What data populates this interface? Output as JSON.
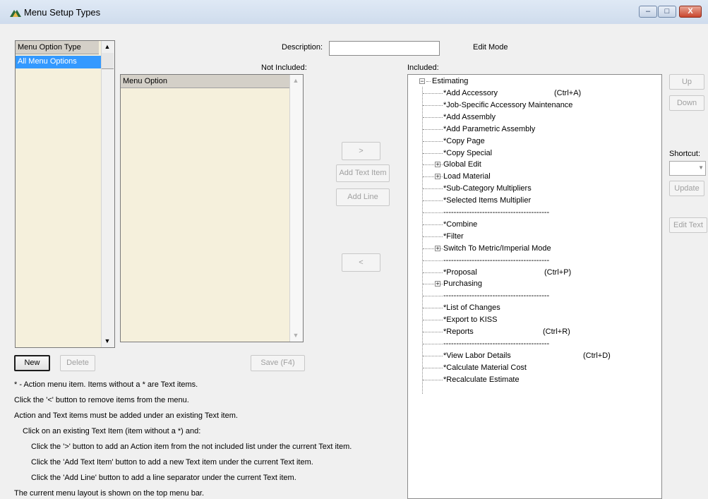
{
  "window": {
    "title": "Menu Setup Types",
    "minimize": "–",
    "maximize": "□",
    "close": "X"
  },
  "menu_type_list": {
    "header": "Menu Option Type",
    "items": [
      "All Menu Options"
    ]
  },
  "description": {
    "label": "Description:",
    "value": ""
  },
  "edit_mode_label": "Edit Mode",
  "not_included": {
    "label": "Not Included:",
    "header": "Menu Option"
  },
  "included": {
    "label": "Included:",
    "root": "Estimating",
    "items": [
      {
        "text": "*Add Accessory",
        "shortcut": "(Ctrl+A)",
        "expander": false
      },
      {
        "text": "*Job-Specific Accessory Maintenance",
        "shortcut": "",
        "expander": false
      },
      {
        "text": "*Add Assembly",
        "shortcut": "",
        "expander": false
      },
      {
        "text": "*Add Parametric Assembly",
        "shortcut": "",
        "expander": false
      },
      {
        "text": "*Copy Page",
        "shortcut": "",
        "expander": false
      },
      {
        "text": "*Copy Special",
        "shortcut": "",
        "expander": false
      },
      {
        "text": "Global Edit",
        "shortcut": "",
        "expander": true
      },
      {
        "text": "Load Material",
        "shortcut": "",
        "expander": true
      },
      {
        "text": "*Sub-Category Multipliers",
        "shortcut": "",
        "expander": false
      },
      {
        "text": "*Selected Items Multiplier",
        "shortcut": "",
        "expander": false
      },
      {
        "text": "-----------------------------------------",
        "shortcut": "",
        "expander": false
      },
      {
        "text": "*Combine",
        "shortcut": "",
        "expander": false
      },
      {
        "text": "*Filter",
        "shortcut": "",
        "expander": false
      },
      {
        "text": "Switch To Metric/Imperial Mode",
        "shortcut": "",
        "expander": true
      },
      {
        "text": "-----------------------------------------",
        "shortcut": "",
        "expander": false
      },
      {
        "text": "*Proposal",
        "shortcut": "(Ctrl+P)",
        "expander": false
      },
      {
        "text": "Purchasing",
        "shortcut": "",
        "expander": true
      },
      {
        "text": "-----------------------------------------",
        "shortcut": "",
        "expander": false
      },
      {
        "text": "*List of Changes",
        "shortcut": "",
        "expander": false
      },
      {
        "text": "*Export to KISS",
        "shortcut": "",
        "expander": false
      },
      {
        "text": "*Reports",
        "shortcut": "(Ctrl+R)",
        "expander": false
      },
      {
        "text": "-----------------------------------------",
        "shortcut": "",
        "expander": false
      },
      {
        "text": "*View Labor Details",
        "shortcut": "(Ctrl+D)",
        "expander": false
      },
      {
        "text": "*Calculate Material Cost",
        "shortcut": "",
        "expander": false
      },
      {
        "text": "*Recalculate Estimate",
        "shortcut": "",
        "expander": false
      }
    ]
  },
  "buttons": {
    "move_right": ">",
    "add_text_item": "Add Text Item",
    "add_line": "Add Line",
    "move_left": "<",
    "up": "Up",
    "down": "Down",
    "update": "Update",
    "edit_text": "Edit Text",
    "new": "New",
    "delete": "Delete",
    "save": "Save (F4)"
  },
  "shortcut": {
    "label": "Shortcut:",
    "value": ""
  },
  "help": [
    "* - Action menu item.  Items without a * are Text items.",
    "Click the '<' button to remove items from the menu.",
    "Action and Text items must be added under an existing Text item.",
    "Click on an existing Text Item (item without a *) and:",
    "Click the '>' button to add an Action item from the not included list under the current Text item.",
    "Click the 'Add Text Item' button to add a new Text item under the current Text item.",
    "Click the 'Add Line' button to add a line separator under the current Text item.",
    "The current menu layout is shown on the top menu bar."
  ],
  "colors": {
    "selection": "#3399ff",
    "list_background": "#f5f0dc",
    "titlebar": "#cfdced"
  }
}
